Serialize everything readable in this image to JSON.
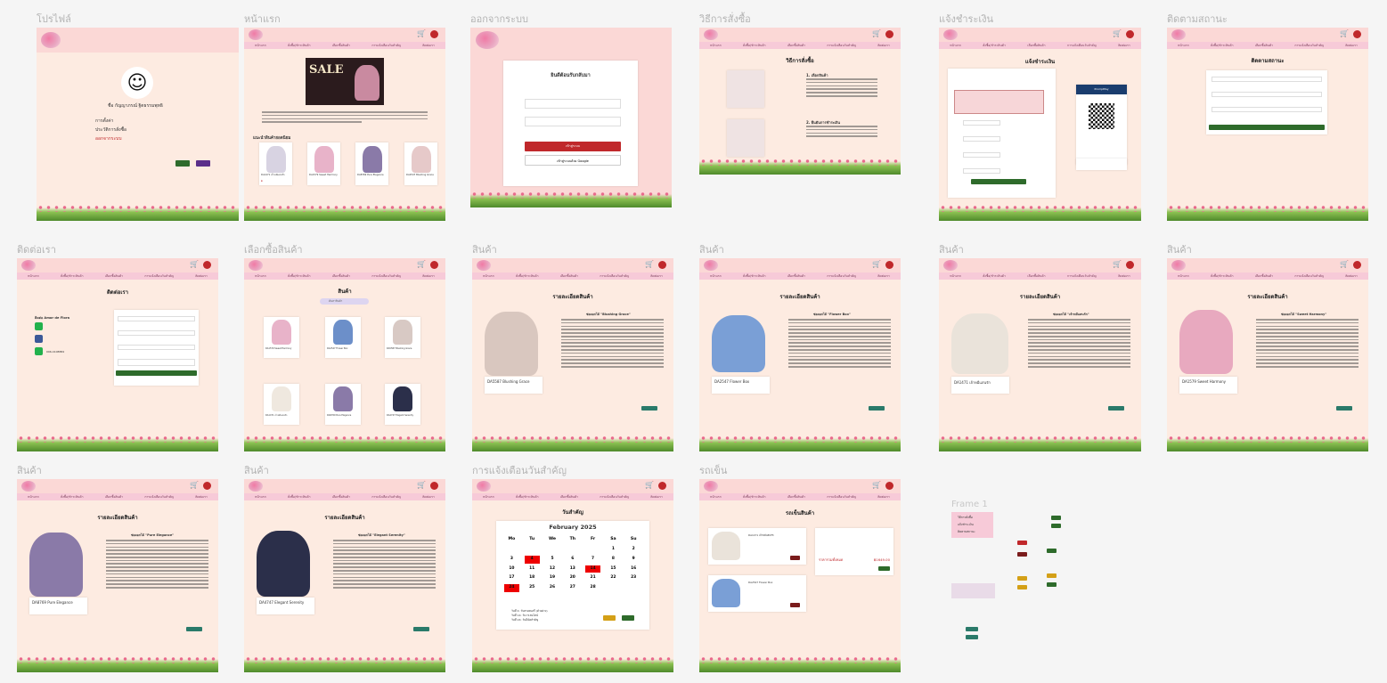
{
  "frames": {
    "profile": {
      "title": "โปรไฟล์",
      "user_name": "ชื่อ กัญญาภรณ์ ฐิตธรรมพุทธิ",
      "menu": [
        "การตั้งค่า",
        "ประวัติการสั่งซื้อ",
        "ออกจากระบบ"
      ]
    },
    "home": {
      "title": "หน้าแรก",
      "section": "แนะนำสินค้ายอดนิยม",
      "products": [
        "DA1471 เจ้าหมีแสนรัก",
        "DA1579 Sweet Harmony",
        "DA8769 Pure Elegance",
        "DA2547 Blushing Grace"
      ]
    },
    "logout": {
      "title": "ออกจากระบบ",
      "heading": "ยินดีต้อนรับกลับมา",
      "login_button": "เข้าสู่ระบบ",
      "google_button": "เข้าสู่ระบบด้วย Google"
    },
    "howto": {
      "title": "วิธีการสั่งซื้อ",
      "heading": "วิธีการสั่งซื้อ",
      "step1": "1. เลือกสินค้า",
      "step2": "2. ยืนยันการชำระเงิน"
    },
    "payment": {
      "title": "แจ้งชำระเงิน",
      "heading": "แจ้งชำระเงิน",
      "qr_label": "PromptPay"
    },
    "tracking": {
      "title": "ติดตามสถานะ",
      "heading": "ติดตามสถานะ"
    },
    "contact": {
      "title": "ติดต่อเรา",
      "heading": "ติดต่อเรา",
      "shop": "ติดต่อ Amor de Flora",
      "phone": "096-4108884"
    },
    "choose": {
      "title": "เลือกซื้อสินค้า",
      "heading": "สินค้า",
      "search_placeholder": "ค้นหาสินค้า",
      "products": [
        "DA1579 Sweet Harmony",
        "DA2547 Flower Box",
        "DA5587 Blushing Grace",
        "DA1471 เจ้าหมีแสนรัก",
        "DA8769 Pure Elegance",
        "DA4747 Elegant Serenity"
      ]
    },
    "detail_heading": "รายละเอียดสินค้า",
    "product_frame_title": "สินค้า",
    "details": [
      {
        "name": "DA5587 Blushing Grace",
        "tag": "ช่อดอกไม้ \"Blushing Grace\""
      },
      {
        "name": "DA2547 Flower Box",
        "tag": "ช่อดอกไม้ \"Flower Box\""
      },
      {
        "name": "DA1471 เจ้าหมีแสนรัก",
        "tag": "ช่อดอกไม้ \"เจ้าหมีแสนรัก\""
      },
      {
        "name": "DA1579 Sweet Harmony",
        "tag": "ช่อดอกไม้ \"Sweet Harmony\""
      },
      {
        "name": "DA8769 Pure Elegance",
        "tag": "ช่อดอกไม้ \"Pure Elegance\""
      },
      {
        "name": "DA4747 Elegant Serenity",
        "tag": "ช่อดอกไม้ \"Elegant Serenity\""
      }
    ],
    "calendar": {
      "title": "การแจ้งเตือนวันสำคัญ",
      "heading": "วันสำคัญ",
      "month": "February 2025",
      "weekdays": [
        "Mo",
        "Tu",
        "We",
        "Th",
        "Fr",
        "Sa",
        "Su"
      ],
      "notes": [
        "วันที่ 4: วันทรงดนตรี (ตัวอย่าง)",
        "วันที่ 14: วันวาเลนไทน์",
        "วันที่ 24: วันมีนัดสำคัญ"
      ]
    },
    "cart": {
      "title": "รถเข็น",
      "heading": "รถเข็นสินค้า",
      "items": [
        "DA1471 เจ้าหมีแสนรัก",
        "DA2547 Flower Box"
      ],
      "total_label": "ราคารวมทั้งหมด",
      "total": "฿1649.00"
    },
    "components": {
      "title": "Frame 1",
      "menu": [
        "วิธีการสั่งซื้อ",
        "แจ้งชำระเงิน",
        "ติดตามสถานะ"
      ]
    }
  },
  "nav": [
    "หน้าแรก",
    "สั่งซื้อ/ชำระสินค้า",
    "เลือกซื้อสินค้า",
    "การแจ้งเตือนวันสำคัญ",
    "ติดต่อเรา"
  ],
  "colors": {
    "header": "#fbd8d6",
    "nav": "#f7cad8",
    "page": "#fdebe1",
    "accent": "#c0282b",
    "button": "#2e6b2b"
  }
}
